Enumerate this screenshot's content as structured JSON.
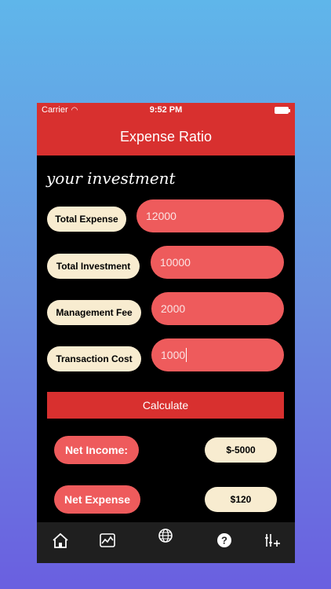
{
  "status": {
    "carrier": "Carrier",
    "time": "9:52 PM"
  },
  "header": {
    "title": "Expense Ratio"
  },
  "section_title": "your investment",
  "fields": [
    {
      "label": "Total Expense",
      "value": "12000"
    },
    {
      "label": "Total Investment",
      "value": "10000"
    },
    {
      "label": "Management Fee",
      "value": "2000"
    },
    {
      "label": "Transaction Cost",
      "value": "1000"
    }
  ],
  "calculate_label": "Calculate",
  "results": [
    {
      "label": "Net Income:",
      "value": "$-5000"
    },
    {
      "label": "Net Expense",
      "value": "$120"
    }
  ],
  "tabs": [
    {
      "icon": "home-icon"
    },
    {
      "icon": "chart-icon"
    },
    {
      "icon": "globe-icon"
    },
    {
      "icon": "help-icon"
    },
    {
      "icon": "sliders-icon"
    }
  ],
  "colors": {
    "header": "#d8302f",
    "input": "#ee5b5c",
    "pill": "#f8ecd0"
  }
}
